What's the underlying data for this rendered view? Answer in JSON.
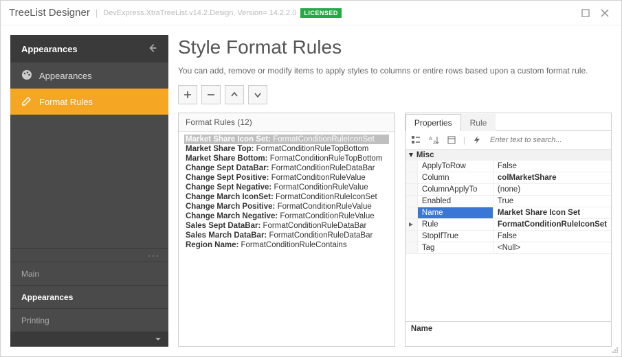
{
  "titlebar": {
    "title": "TreeList Designer",
    "subtitle": "DevExpress.XtraTreeList.v14.2.Design, Version= 14.2.2.0",
    "license": "LICENSED"
  },
  "sidebar": {
    "header": "Appearances",
    "items": [
      {
        "label": "Appearances",
        "active": false
      },
      {
        "label": "Format Rules",
        "active": true
      }
    ],
    "sections": [
      {
        "label": "Main",
        "active": false
      },
      {
        "label": "Appearances",
        "active": true
      },
      {
        "label": "Printing",
        "active": false
      }
    ]
  },
  "main": {
    "heading": "Style Format Rules",
    "description": "You can add, remove or modify items to apply styles to columns or entire rows based upon a custom format rule."
  },
  "rules": {
    "header": "Format Rules (12)",
    "items": [
      {
        "name": "Market Share Icon Set",
        "type": "FormatConditionRuleIconSet",
        "selected": true
      },
      {
        "name": "Market Share Top",
        "type": "FormatConditionRuleTopBottom"
      },
      {
        "name": "Market Share Bottom",
        "type": "FormatConditionRuleTopBottom"
      },
      {
        "name": "Change Sept DataBar",
        "type": "FormatConditionRuleDataBar"
      },
      {
        "name": "Change Sept Positive",
        "type": "FormatConditionRuleValue"
      },
      {
        "name": "Change Sept Negative",
        "type": "FormatConditionRuleValue"
      },
      {
        "name": "Change March IconSet",
        "type": "FormatConditionRuleIconSet"
      },
      {
        "name": "Change March Positive",
        "type": "FormatConditionRuleValue"
      },
      {
        "name": "Change March Negative",
        "type": "FormatConditionRuleValue"
      },
      {
        "name": "Sales Sept DataBar",
        "type": "FormatConditionRuleDataBar"
      },
      {
        "name": "Sales March DataBar",
        "type": "FormatConditionRuleDataBar"
      },
      {
        "name": "Region Name",
        "type": "FormatConditionRuleContains"
      }
    ]
  },
  "props": {
    "tabs": {
      "properties": "Properties",
      "rule": "Rule"
    },
    "search_placeholder": "Enter text to search...",
    "category": "Misc",
    "rows": [
      {
        "name": "ApplyToRow",
        "value": "False"
      },
      {
        "name": "Column",
        "value": "colMarketShare",
        "bold": true
      },
      {
        "name": "ColumnApplyTo",
        "value": "(none)"
      },
      {
        "name": "Enabled",
        "value": "True"
      },
      {
        "name": "Name",
        "value": "Market Share Icon Set",
        "bold": true,
        "selected": true
      },
      {
        "name": "Rule",
        "value": "FormatConditionRuleIconSet",
        "bold": true,
        "expandable": true
      },
      {
        "name": "StopIfTrue",
        "value": "False"
      },
      {
        "name": "Tag",
        "value": "<Null>"
      }
    ],
    "desc_label": "Name"
  }
}
